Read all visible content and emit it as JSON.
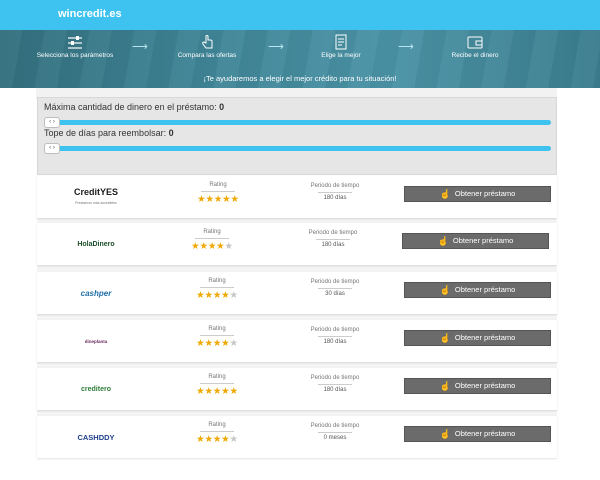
{
  "header": {
    "logo": "wincredit.es"
  },
  "hero": {
    "steps": [
      {
        "label": "Selecciona los parámetros",
        "icon": "sliders-icon"
      },
      {
        "label": "Compara las ofertas",
        "icon": "hand-touch-icon"
      },
      {
        "label": "Elige la mejor",
        "icon": "checklist-icon"
      },
      {
        "label": "Recibe el dinero",
        "icon": "wallet-icon"
      }
    ],
    "message": "¡Te ayudaremos a elegir el mejor crédito para tu situación!"
  },
  "params": {
    "amount_label": "Máxima cantidad de dinero en el préstamo:",
    "amount_value": "0",
    "days_label": "Tope de días para reembolsar:",
    "days_value": "0",
    "slider_knob": "‹ ›"
  },
  "columns": {
    "rating": "Rating",
    "period": "Periodo de tiempo"
  },
  "button_label": "Obtener préstamo",
  "lenders": [
    {
      "name": "CreditYES",
      "tagline": "Préstamos más accesibles",
      "rating": 5,
      "period": "180 días"
    },
    {
      "name": "HolaDinero",
      "rating": 4,
      "period": "180 días"
    },
    {
      "name": "cashper",
      "rating": 4,
      "period": "30 días"
    },
    {
      "name": "dineplanta",
      "rating": 4,
      "period": "180 días"
    },
    {
      "name": "creditero",
      "rating": 5,
      "period": "180 días"
    },
    {
      "name": "CASHDDY",
      "rating": 4,
      "period": "0 meses"
    }
  ],
  "colors": {
    "topbar": "#3ec3f0",
    "slider": "#3ec3f0",
    "button": "#6b6b6b",
    "star": "#f0a800"
  }
}
